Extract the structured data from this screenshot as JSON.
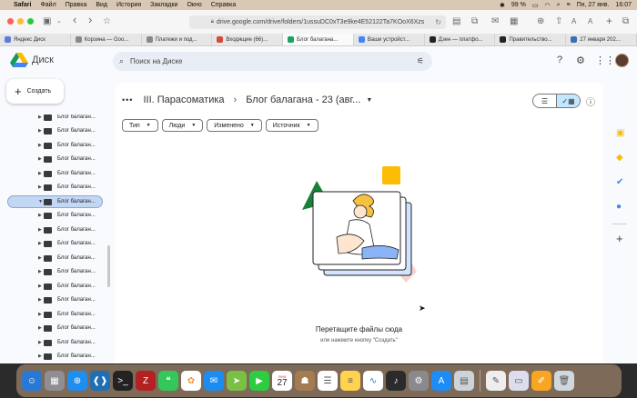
{
  "menubar": {
    "apple": "",
    "app": "Safari",
    "items": [
      "Файл",
      "Правка",
      "Вид",
      "История",
      "Закладки",
      "Окно",
      "Справка"
    ],
    "battery": "99 %",
    "date": "Пн, 27 янв.",
    "time": "16:07"
  },
  "browser": {
    "url": "drive.google.com/drive/folders/1ussuDC0xT3e9ke4E52122Ta7KOoX6Xzs",
    "tabs": [
      {
        "label": "Яндекс Диск",
        "color": "#5b7fd6",
        "active": false
      },
      {
        "label": "Корзина — Goo...",
        "color": "#888",
        "active": false
      },
      {
        "label": "Платежи и под...",
        "color": "#888",
        "active": false
      },
      {
        "label": "Входящие (66)...",
        "color": "#d64a3a",
        "active": false
      },
      {
        "label": "Блог балагана...",
        "color": "#1aa260",
        "active": true
      },
      {
        "label": "Ваши устройст...",
        "color": "#4285f4",
        "active": false
      },
      {
        "label": "Дзен — платфо...",
        "color": "#222",
        "active": false
      },
      {
        "label": "Правительство...",
        "color": "#222",
        "active": false
      },
      {
        "label": "27 января 202...",
        "color": "#3a6fb5",
        "active": false
      }
    ]
  },
  "drive": {
    "brand": "Диск",
    "search_placeholder": "Поиск на Диске",
    "create_label": "Создать",
    "tree": [
      {
        "label": "Блог балаган...",
        "selected": false
      },
      {
        "label": "Блог балаган...",
        "selected": false
      },
      {
        "label": "Блог балаган...",
        "selected": false
      },
      {
        "label": "Блог балаган...",
        "selected": false
      },
      {
        "label": "Блог балаган...",
        "selected": false
      },
      {
        "label": "Блог балаган...",
        "selected": false
      },
      {
        "label": "Блог балаган...",
        "selected": true
      },
      {
        "label": "Блог балаган...",
        "selected": false
      },
      {
        "label": "Блог балаган...",
        "selected": false
      },
      {
        "label": "Блог балаган...",
        "selected": false
      },
      {
        "label": "Блог балаган...",
        "selected": false
      },
      {
        "label": "Блог балаган...",
        "selected": false
      },
      {
        "label": "Блог балаган...",
        "selected": false
      },
      {
        "label": "Блог балаган...",
        "selected": false
      },
      {
        "label": "Блог балаган...",
        "selected": false
      },
      {
        "label": "Блог балаган...",
        "selected": false
      },
      {
        "label": "Блог балаган...",
        "selected": false
      },
      {
        "label": "Блог балаган...",
        "selected": false
      }
    ],
    "breadcrumb": {
      "dots": "•••",
      "parent": "III. Парасоматика",
      "current": "Блог балагана - 23 (авг..."
    },
    "filters": [
      "Тип",
      "Люди",
      "Изменено",
      "Источник"
    ],
    "empty_title": "Перетащите файлы сюда",
    "empty_subtitle": "или нажмите кнопку \"Создать\""
  },
  "dock": {
    "calendar_day": "27",
    "calendar_month": "ЯНВ"
  }
}
